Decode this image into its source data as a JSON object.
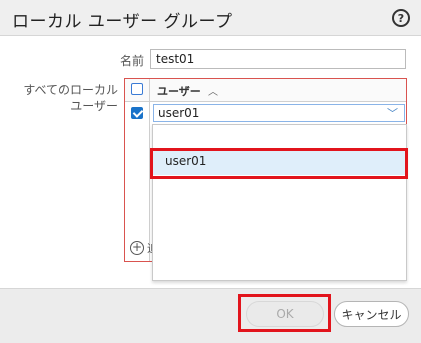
{
  "dialog": {
    "title": "ローカル ユーザー グループ",
    "help_icon": "?"
  },
  "form": {
    "name_label": "名前",
    "name_value": "test01",
    "users_label_line1": "すべてのローカル",
    "users_label_line2": "ユーザー"
  },
  "grid": {
    "column_header": "ユーザー",
    "sort_icon": "^",
    "rows": [
      {
        "checked": true,
        "value": "user01"
      }
    ],
    "add_label": "追"
  },
  "dropdown": {
    "options": [
      "user01"
    ]
  },
  "footer": {
    "ok_label": "OK",
    "cancel_label": "キャンセル"
  },
  "colors": {
    "highlight": "#e2141c",
    "accent": "#1a73c9"
  }
}
